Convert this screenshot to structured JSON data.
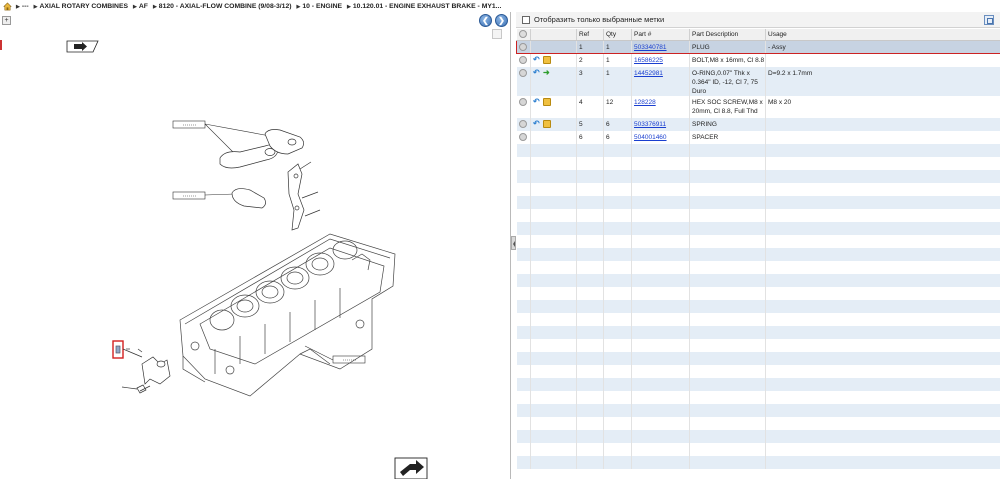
{
  "breadcrumb": {
    "items": [
      "---",
      "AXIAL ROTARY COMBINES",
      "AF",
      "8120 - AXIAL-FLOW COMBINE (9/08-3/12)",
      "10 - ENGINE",
      "10.120.01 - ENGINE EXHAUST BRAKE - MY1..."
    ]
  },
  "left": {
    "expand_label": "+",
    "nav_back_glyph": "❮",
    "nav_forward_glyph": "❯"
  },
  "filter": {
    "label": "Отобразить только выбранные метки"
  },
  "table": {
    "columns": [
      "Ref",
      "Qty",
      "Part #",
      "Part Description",
      "Usage"
    ],
    "rows": [
      {
        "ref": "1",
        "qty": "1",
        "part": "503340781",
        "desc": "PLUG",
        "usage": "- Assy",
        "icons": "none"
      },
      {
        "ref": "2",
        "qty": "1",
        "part": "16586225",
        "desc": "BOLT,M8 x 16mm, Cl 8.8",
        "usage": "",
        "icons": "swap-box"
      },
      {
        "ref": "3",
        "qty": "1",
        "part": "14452981",
        "desc": "O-RING,0.07\" Thk x 0.364\" ID, -12, Cl 7, 75 Duro",
        "usage": "D=9.2 x 1.7mm",
        "icons": "swap-green"
      },
      {
        "ref": "4",
        "qty": "12",
        "part": "128228",
        "desc": "HEX SOC SCREW,M8 x 20mm, Cl 8.8, Full Thd",
        "usage": "M8 x 20",
        "icons": "swap-box"
      },
      {
        "ref": "5",
        "qty": "6",
        "part": "503376911",
        "desc": "SPRING",
        "usage": "",
        "icons": "swap-box"
      },
      {
        "ref": "6",
        "qty": "6",
        "part": "504001460",
        "desc": "SPACER",
        "usage": "",
        "icons": "none"
      }
    ]
  }
}
